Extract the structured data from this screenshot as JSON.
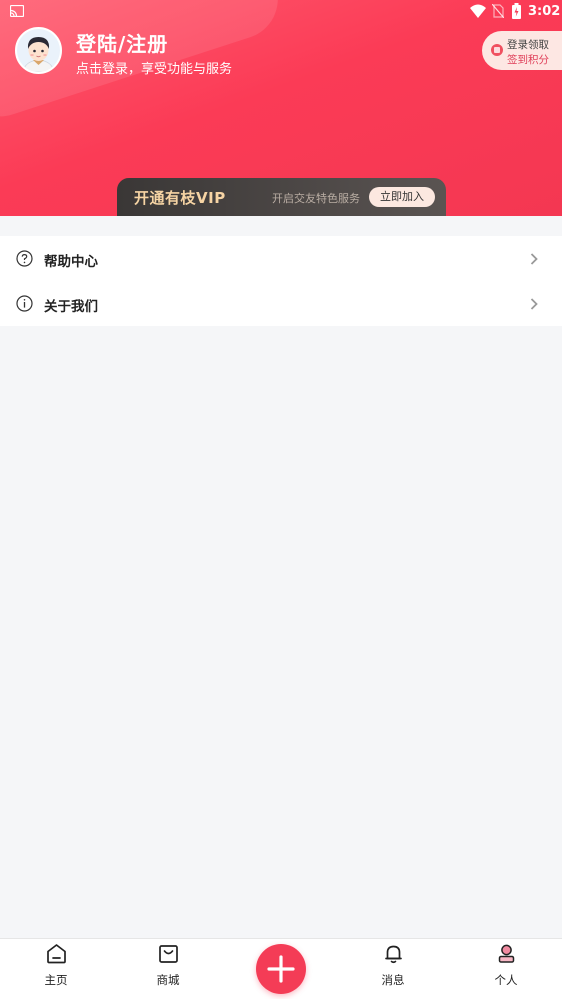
{
  "status_bar": {
    "time": "3:02"
  },
  "header": {
    "login_title": "登陆/注册",
    "login_subtitle": "点击登录，享受功能与服务",
    "points_line1": "登录领取",
    "points_line2": "签到积分"
  },
  "vip": {
    "title": "开通有枝VIP",
    "description": "开启交友特色服务",
    "join_label": "立即加入"
  },
  "menu": [
    {
      "label": "帮助中心",
      "icon": "question-circle-icon"
    },
    {
      "label": "关于我们",
      "icon": "info-circle-icon"
    }
  ],
  "tabbar": {
    "home": "主页",
    "mall": "商城",
    "messages": "消息",
    "profile": "个人"
  },
  "colors": {
    "accent": "#f43c56",
    "vip_gold": "#f6d4a4",
    "background": "#f5f6f8"
  }
}
